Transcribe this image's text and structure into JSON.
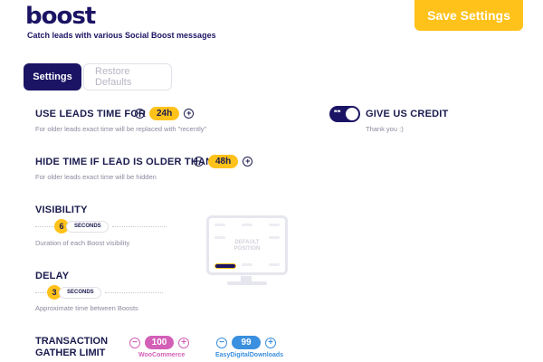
{
  "header": {
    "logo": "boost",
    "tagline": "Catch leads with various Social Boost messages",
    "save_label": "Save Settings"
  },
  "tabs": [
    {
      "label": "Settings",
      "active": true
    },
    {
      "label": "Restore Defaults",
      "active": false
    }
  ],
  "leads_time": {
    "title": "USE LEADS TIME FOR",
    "value": "24h",
    "hint": "For older leads exact time will be replaced with \"recently\""
  },
  "hide_time": {
    "title": "HIDE TIME IF LEAD IS OLDER THAN",
    "value": "48h",
    "hint": "For older leads exact time will be hidden"
  },
  "credit": {
    "title": "GIVE US CREDIT",
    "hint": "Thank you :)",
    "enabled": true,
    "toggle_icon": "quote-icon"
  },
  "visibility": {
    "title": "VISIBILITY",
    "value": "6",
    "unit": "SECONDS",
    "hint": "Duration of each Boost visibility"
  },
  "delay": {
    "title": "DELAY",
    "value": "3",
    "unit": "SECONDS",
    "hint": "Approximate time between Boosts"
  },
  "position": {
    "label_line1": "DEFAULT",
    "label_line2": "POSITION"
  },
  "transaction": {
    "title_line1": "TRANSACTION",
    "title_line2": "GATHER LIMIT",
    "woo": {
      "value": "100",
      "label": "WooCommerce",
      "color": "#d35fb7"
    },
    "edd": {
      "value": "99",
      "label": "EasyDigitalDownloads",
      "color": "#3a8fde"
    }
  },
  "colors": {
    "accent": "#ffc21a",
    "brand": "#1b1464"
  },
  "controls": {
    "minus": "−",
    "plus": "+"
  }
}
